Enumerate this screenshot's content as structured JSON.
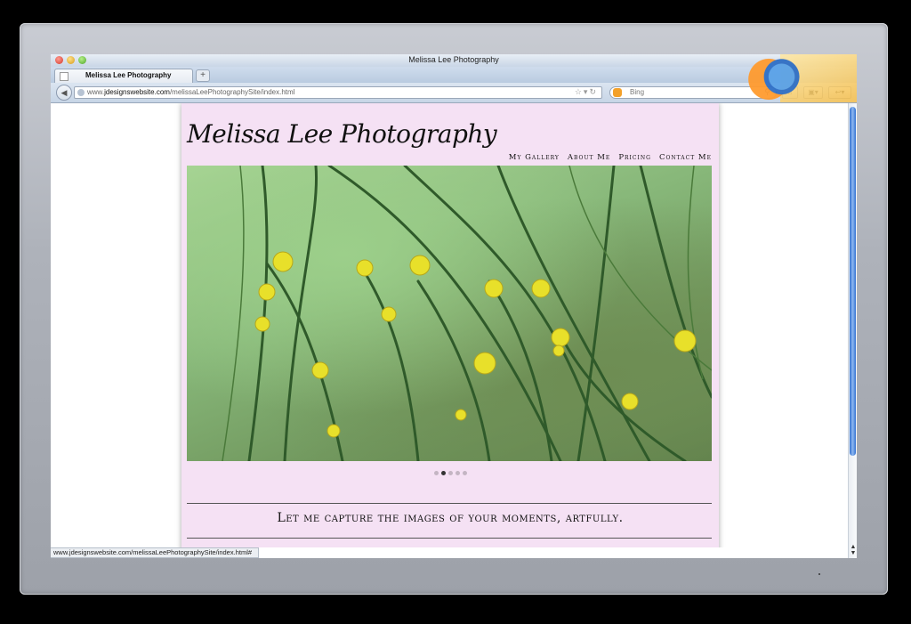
{
  "window": {
    "title": "Melissa Lee Photography"
  },
  "tab": {
    "label": "Melissa Lee Photography",
    "new_tab_symbol": "+"
  },
  "address_bar": {
    "url_prefix": "www.",
    "url_domain": "jdesignswebsite.com",
    "url_path": "/melissaLeePhotographySite/index.html"
  },
  "search_bar": {
    "engine_name": "Bing"
  },
  "site": {
    "title": "Melissa Lee Photography",
    "nav": [
      "My Gallery",
      "About Me",
      "Pricing",
      "Contact Me"
    ],
    "slideshow": {
      "slide_count": 5,
      "active_index": 1
    },
    "tagline": "Let me capture the images of your moments, artfully."
  },
  "status_bar": {
    "text": "www.jdesignswebsite.com/melissaLeePhotographySite/index.html#"
  },
  "icons": {
    "back": "back-arrow-icon",
    "globe": "site-identity-icon",
    "bookmark": "star-icon",
    "reload": "reload-icon",
    "search": "magnifier-icon"
  },
  "colors": {
    "page_background": "#f5e1f4",
    "flower_yellow": "#e8e02a",
    "stem_green": "#2f5a2a"
  }
}
